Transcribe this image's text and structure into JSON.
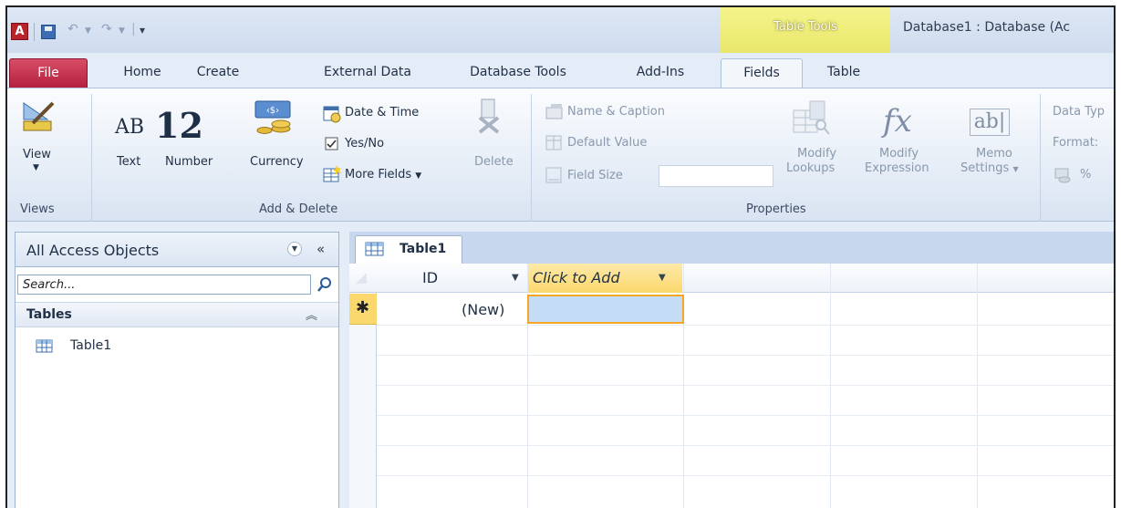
{
  "titlebar": {
    "app_icon": "A",
    "contextual_tab": "Table Tools",
    "window_title": "Database1 : Database (Ac",
    "icons": [
      "access-app-icon",
      "save-icon",
      "undo-icon",
      "redo-icon",
      "customize-qat-icon"
    ]
  },
  "tabs": [
    {
      "label": "File"
    },
    {
      "label": "Home"
    },
    {
      "label": "Create"
    },
    {
      "label": "External Data"
    },
    {
      "label": "Database Tools"
    },
    {
      "label": "Add-Ins"
    },
    {
      "label": "Fields"
    },
    {
      "label": "Table"
    }
  ],
  "ribbon": {
    "views": {
      "view_label": "View",
      "group": "Views"
    },
    "add_delete": {
      "text_big": "AB",
      "text_label": "Text",
      "number_big": "12",
      "number_label": "Number",
      "currency_label": "Currency",
      "date_time": "Date & Time",
      "yes_no": "Yes/No",
      "more_fields": "More Fields",
      "delete": "Delete",
      "group": "Add & Delete"
    },
    "properties": {
      "name_caption": "Name & Caption",
      "default_value": "Default Value",
      "field_size": "Field Size",
      "modify_lookups_1": "Modify",
      "modify_lookups_2": "Lookups",
      "modify_expression_1": "Modify",
      "modify_expression_2": "Expression",
      "memo_settings_1": "Memo",
      "memo_settings_2": "Settings",
      "fx": "fx",
      "ab": "ab|",
      "group": "Properties"
    },
    "formatting": {
      "data_type": "Data Typ",
      "format": "Format:",
      "percent": "%"
    }
  },
  "nav": {
    "title": "All Access Objects",
    "search_placeholder": "Search...",
    "section": "Tables",
    "items": [
      {
        "label": "Table1"
      }
    ]
  },
  "document": {
    "tab": "Table1",
    "columns": [
      {
        "label": "ID"
      },
      {
        "label": "Click to Add"
      }
    ],
    "new_row": {
      "marker": "✱",
      "id": "(New)"
    }
  }
}
